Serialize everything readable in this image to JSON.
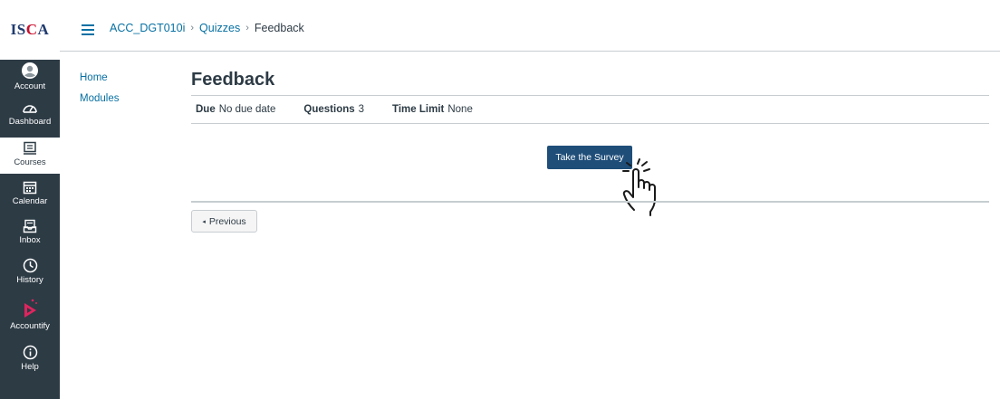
{
  "logo": {
    "text_main": "IS",
    "text_accent": "C",
    "text_end": "A"
  },
  "global_nav": {
    "items": [
      {
        "label": "Account",
        "icon": "account-icon"
      },
      {
        "label": "Dashboard",
        "icon": "dashboard-icon"
      },
      {
        "label": "Courses",
        "icon": "courses-icon",
        "active": true
      },
      {
        "label": "Calendar",
        "icon": "calendar-icon"
      },
      {
        "label": "Inbox",
        "icon": "inbox-icon"
      },
      {
        "label": "History",
        "icon": "history-icon"
      },
      {
        "label": "Accountify",
        "icon": "accountify-icon"
      },
      {
        "label": "Help",
        "icon": "help-icon"
      }
    ]
  },
  "breadcrumb": {
    "course": "ACC_DGT010i",
    "section": "Quizzes",
    "current": "Feedback",
    "separator": "›"
  },
  "course_nav": {
    "items": [
      "Home",
      "Modules"
    ]
  },
  "quiz": {
    "title": "Feedback",
    "due_label": "Due",
    "due_value": "No due date",
    "questions_label": "Questions",
    "questions_value": "3",
    "time_limit_label": "Time Limit",
    "time_limit_value": "None",
    "take_button": "Take the Survey"
  },
  "footer_nav": {
    "previous": "Previous",
    "previous_arrow": "◂"
  },
  "colors": {
    "nav_bg": "#2d3b45",
    "link": "#0770a3",
    "primary_button": "#1f4e79",
    "accountify": "#e0245e",
    "logo_blue": "#1f3a6e",
    "logo_red": "#c8102e"
  }
}
